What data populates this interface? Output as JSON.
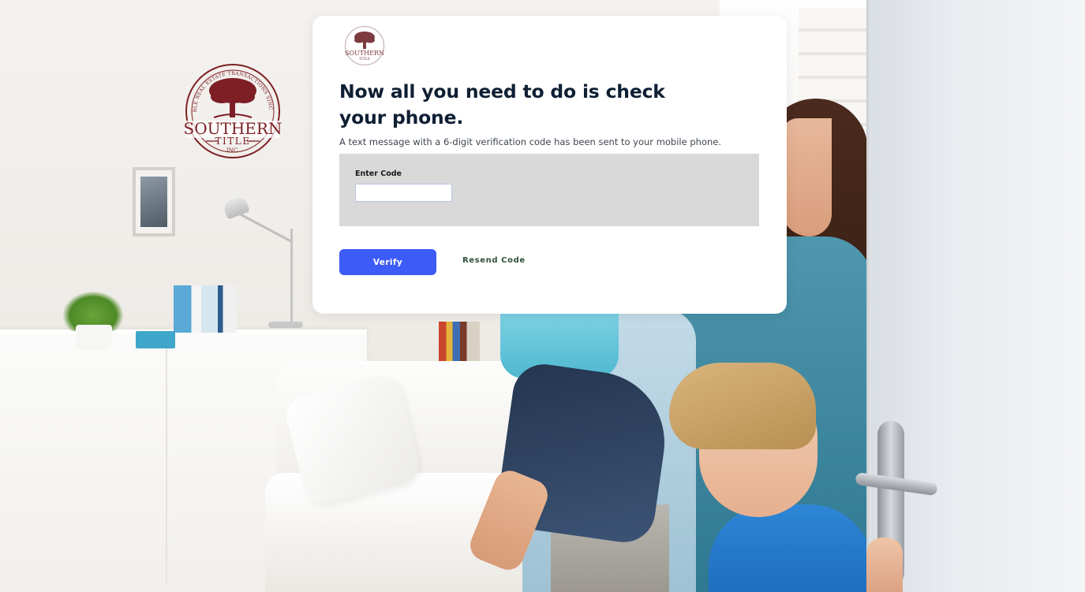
{
  "brand": {
    "logo_lines": [
      "RELIABLE REAL ESTATE TRANSACTIONS SINCE 1998",
      "SOUTHERN",
      "TITLE",
      "INC."
    ],
    "color": "#7d1f24"
  },
  "card": {
    "title": "Now all you need to do is check your phone.",
    "subtitle": "A text message with a 6-digit verification code has been sent to your mobile phone.",
    "code_label": "Enter Code",
    "code_value": "",
    "verify_label": "Verify",
    "resend_label": "Resend Code"
  },
  "colors": {
    "primary_button": "#3d5bf6",
    "code_panel": "#d9d9d9",
    "title_text": "#0f1f33",
    "resend_text": "#2f4f3a"
  },
  "icons": {
    "logo": "southern-title-tree-seal"
  }
}
